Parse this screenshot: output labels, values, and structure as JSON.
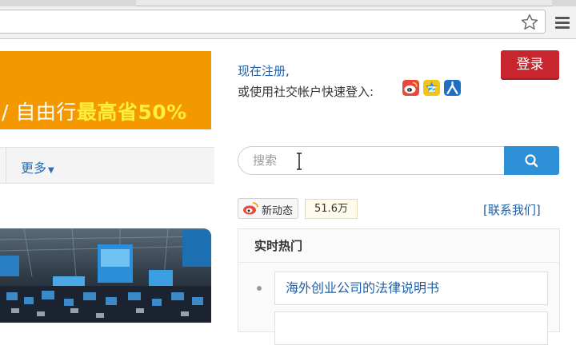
{
  "header": {
    "login_label": "登录",
    "register_link": "现在注册",
    "register_suffix": ",",
    "social_prefix": "或使用社交帐户快速登入:"
  },
  "social_icons": [
    "weibo-icon",
    "qq-space-icon",
    "renren-icon"
  ],
  "banner": {
    "text_prefix": "/ 自由行",
    "text_highlight": "最高省50%",
    "color": "#f39800"
  },
  "nav": {
    "more_label": "更多"
  },
  "search": {
    "placeholder": "搜索"
  },
  "weibo": {
    "label": "新动态",
    "count": "51.6万"
  },
  "contact_label": "[联系我们]",
  "hot": {
    "title": "实时热门",
    "items": [
      "海外创业公司的法律说明书"
    ]
  },
  "colors": {
    "accent_blue": "#2d8fd5",
    "login_red": "#c9252f",
    "link_blue": "#1f5fa6"
  }
}
